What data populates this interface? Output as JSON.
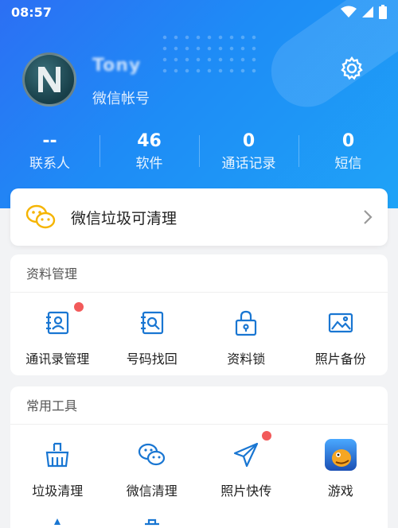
{
  "status_bar": {
    "time": "08:57"
  },
  "profile": {
    "username": "Tony",
    "account_label": "微信帐号"
  },
  "stats": [
    {
      "value": "--",
      "label": "联系人"
    },
    {
      "value": "46",
      "label": "软件"
    },
    {
      "value": "0",
      "label": "通话记录"
    },
    {
      "value": "0",
      "label": "短信"
    }
  ],
  "banner": {
    "title": "微信垃圾可清理"
  },
  "data_management": {
    "title": "资料管理",
    "items": [
      {
        "label": "通讯录管理",
        "icon": "contacts-icon",
        "badge": true
      },
      {
        "label": "号码找回",
        "icon": "number-search-icon",
        "badge": false
      },
      {
        "label": "资料锁",
        "icon": "lock-icon",
        "badge": false
      },
      {
        "label": "照片备份",
        "icon": "photo-icon",
        "badge": false
      }
    ]
  },
  "tools": {
    "title": "常用工具",
    "items": [
      {
        "label": "垃圾清理",
        "icon": "broom-icon",
        "badge": false
      },
      {
        "label": "微信清理",
        "icon": "wechat-icon",
        "badge": true
      },
      {
        "label": "照片快传",
        "icon": "paper-plane-icon",
        "badge": false
      },
      {
        "label": "游戏",
        "icon": "game-app-icon",
        "badge": false
      }
    ]
  },
  "colors": {
    "primary": "#1f8cf6",
    "icon_blue": "#1976d2",
    "badge_red": "#f25a5a",
    "wechat_yellow": "#f5b400"
  }
}
